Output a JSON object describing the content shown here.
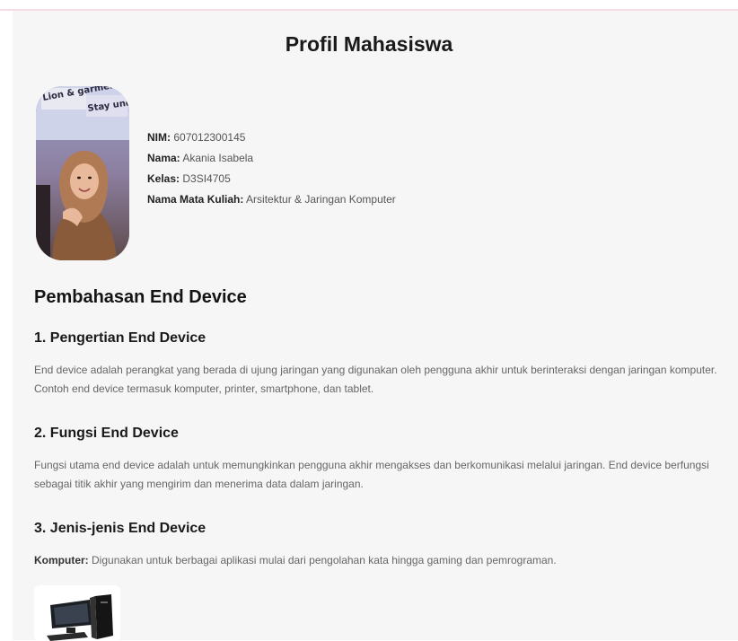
{
  "page": {
    "title": "Profil Mahasiswa"
  },
  "profile": {
    "photo_caption": "Lion & garment Stay under",
    "nim_label": "NIM:",
    "nim_value": "607012300145",
    "nama_label": "Nama:",
    "nama_value": "Akania Isabela",
    "kelas_label": "Kelas:",
    "kelas_value": "D3SI4705",
    "matkul_label": "Nama Mata Kuliah:",
    "matkul_value": "Arsitektur & Jaringan Komputer"
  },
  "content": {
    "section_title": "Pembahasan End Device",
    "s1_title": "1. Pengertian End Device",
    "s1_text": "End device adalah perangkat yang berada di ujung jaringan yang digunakan oleh pengguna akhir untuk berinteraksi dengan jaringan komputer. Contoh end device termasuk komputer, printer, smartphone, dan tablet.",
    "s2_title": "2. Fungsi End Device",
    "s2_text": "Fungsi utama end device adalah untuk memungkinkan pengguna akhir mengakses dan berkomunikasi melalui jaringan. End device berfungsi sebagai titik akhir yang mengirim dan menerima data dalam jaringan.",
    "s3_title": "3. Jenis-jenis End Device",
    "komputer_label": "Komputer:",
    "komputer_text": "Digunakan untuk berbagai aplikasi mulai dari pengolahan kata hingga gaming dan pemrograman."
  },
  "icons": {
    "computer": "desktop-computer-icon"
  }
}
